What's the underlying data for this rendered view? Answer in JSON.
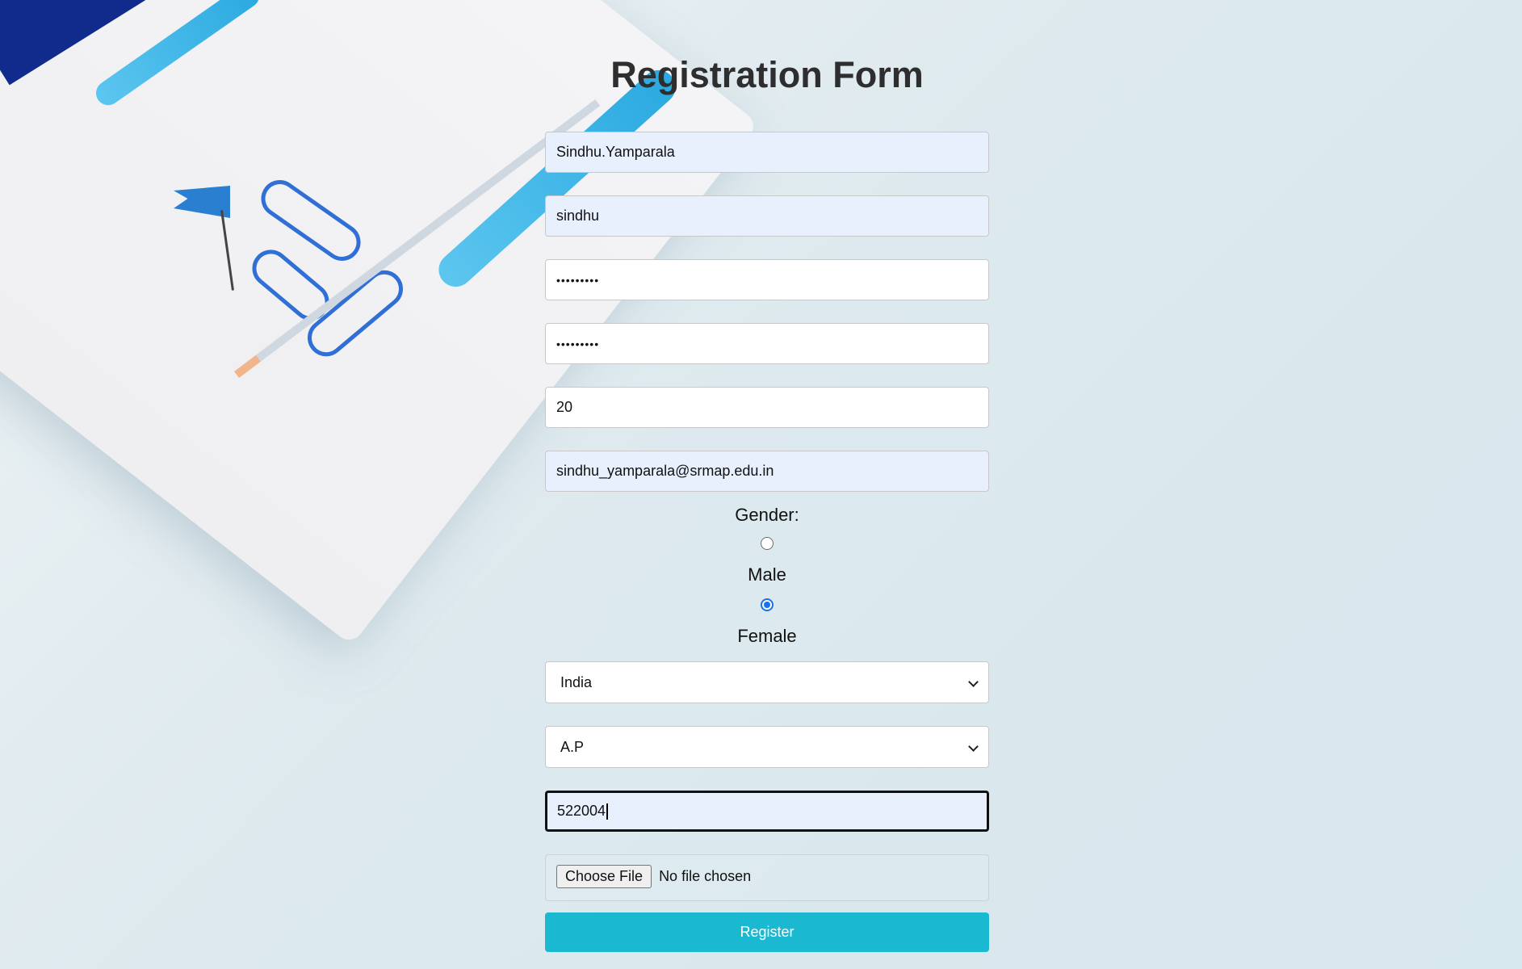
{
  "form": {
    "title": "Registration Form",
    "full_name": "Sindhu.Yamparala",
    "username": "sindhu",
    "password": "•••••••••",
    "confirm_password": "•••••••••",
    "age": "20",
    "email": "sindhu_yamparala@srmap.edu.in",
    "gender_label": "Gender:",
    "gender_options": [
      {
        "label": "Male",
        "checked": false
      },
      {
        "label": "Female",
        "checked": true
      }
    ],
    "country": "India",
    "state": "A.P",
    "pincode": "522004",
    "file_button": "Choose File",
    "file_status": "No file chosen",
    "submit_label": "Register"
  },
  "colors": {
    "accent": "#1bb8d2",
    "radio_selected": "#1a73e8",
    "autofill_bg": "#e8f0fe"
  }
}
